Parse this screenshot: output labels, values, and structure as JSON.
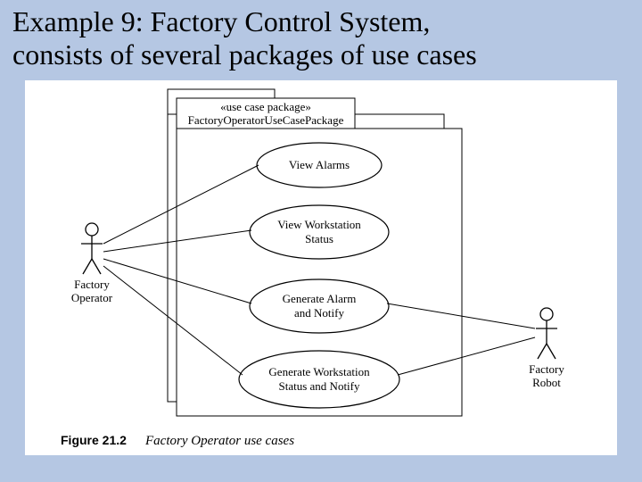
{
  "title_line1": "Example 9: Factory Control System,",
  "title_line2": "consists of several packages of use cases",
  "package_stereotype": "«use case package»",
  "package_name": "FactoryOperatorUseCasePackage",
  "usecases": {
    "a": "View Alarms",
    "b1": "View Workstation",
    "b2": "Status",
    "c1": "Generate Alarm",
    "c2": "and Notify",
    "d1": "Generate Workstation",
    "d2": "Status and Notify"
  },
  "actors": {
    "operator1": "Factory",
    "operator2": "Operator",
    "robot1": "Factory",
    "robot2": "Robot"
  },
  "caption_bold": "Figure 21.2",
  "caption_ital": "Factory Operator use cases"
}
